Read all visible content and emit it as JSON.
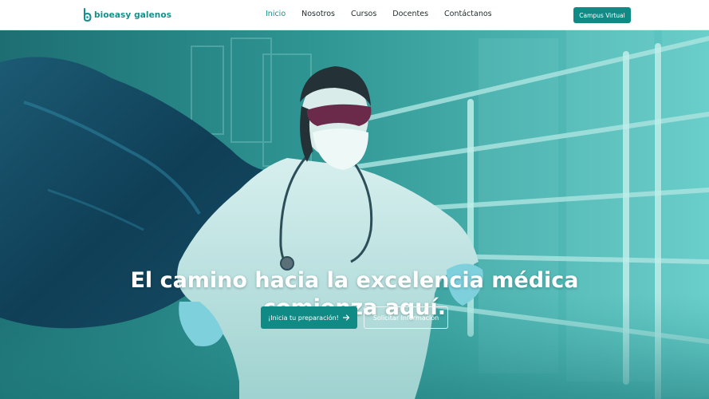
{
  "header": {
    "logo_text": "bioeasy galenos",
    "nav": [
      "Inicio",
      "Nosotros",
      "Cursos",
      "Docentes",
      "Contáctanos"
    ],
    "active_nav": "Inicio",
    "campus_button": "Campus Virtual"
  },
  "hero": {
    "title_line1": "El camino hacia la excelencia médica",
    "title_line2": "comienza aquí.",
    "primary_cta": "¡Inicia tu preparación!",
    "primary_cta_icon": "arrow-right-icon",
    "secondary_cta": "Solicitar Información"
  },
  "colors": {
    "brand": "#14908b",
    "button": "#0f8a84",
    "overlay_teal": "#3aa9a8"
  }
}
